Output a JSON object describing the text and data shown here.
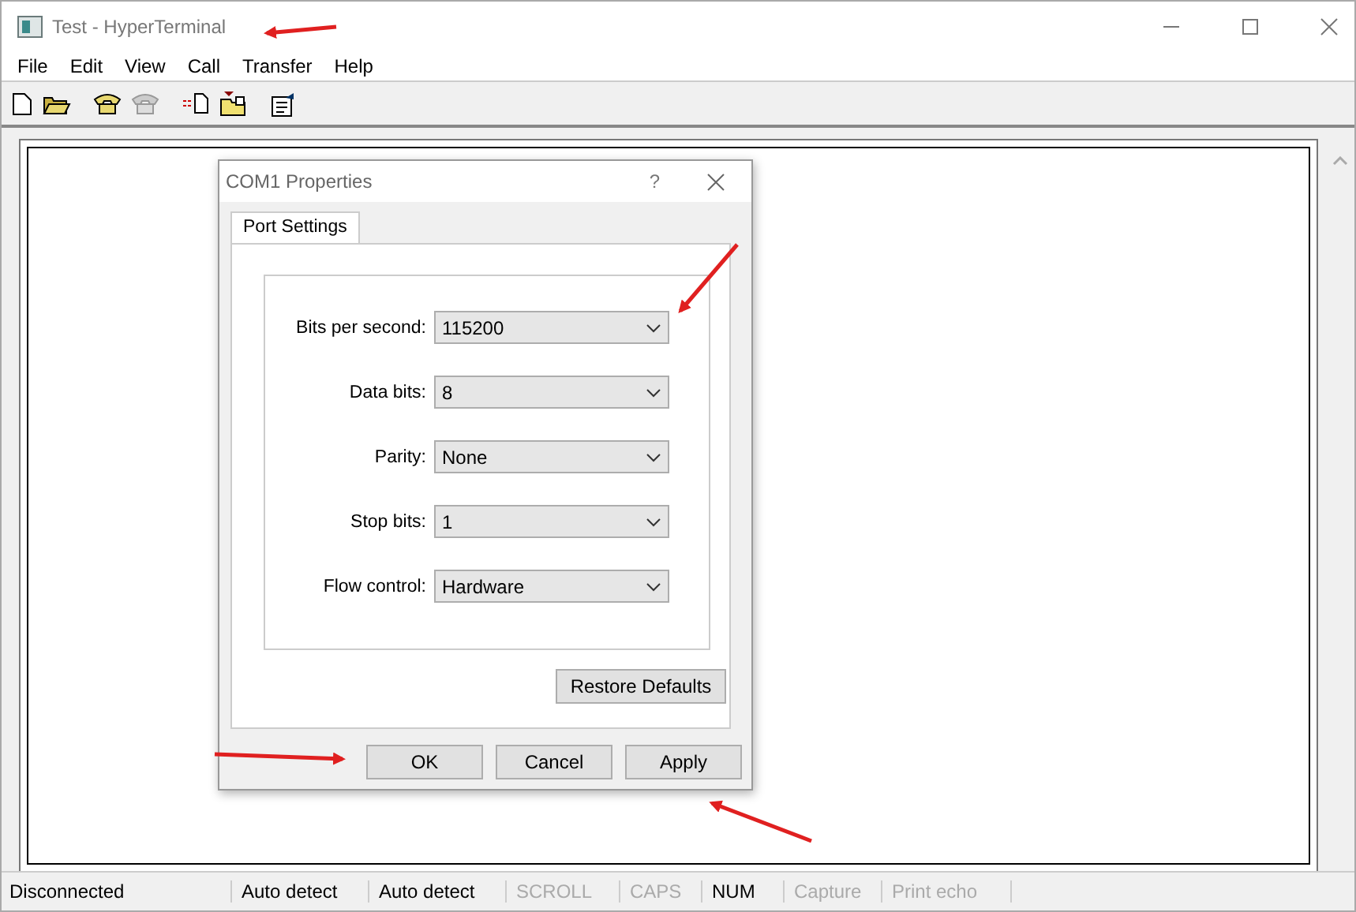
{
  "window": {
    "title": "Test - HyperTerminal"
  },
  "menu": [
    "File",
    "Edit",
    "View",
    "Call",
    "Transfer",
    "Help"
  ],
  "toolbar": [
    {
      "kind": "new"
    },
    {
      "kind": "open"
    },
    {
      "kind": "call",
      "disabled": false
    },
    {
      "kind": "disconnect",
      "disabled": true
    },
    {
      "kind": "send"
    },
    {
      "kind": "receive"
    },
    {
      "kind": "properties"
    }
  ],
  "dialog": {
    "title": "COM1 Properties",
    "help": "?",
    "tabs": [
      {
        "label": "Port Settings",
        "selected": true
      }
    ],
    "fields": [
      {
        "label": "Bits per second:",
        "value": "115200"
      },
      {
        "label": "Data bits:",
        "value": "8"
      },
      {
        "label": "Parity:",
        "value": "None"
      },
      {
        "label": "Stop bits:",
        "value": "1"
      },
      {
        "label": "Flow control:",
        "value": "Hardware"
      }
    ],
    "restore_button": "Restore Defaults",
    "buttons": [
      "OK",
      "Cancel",
      "Apply"
    ]
  },
  "status_bar": [
    {
      "text": "Disconnected",
      "disabled": false
    },
    {
      "text": "Auto detect",
      "disabled": false
    },
    {
      "text": "Auto detect",
      "disabled": false
    },
    {
      "text": "SCROLL",
      "disabled": true
    },
    {
      "text": "CAPS",
      "disabled": true
    },
    {
      "text": "NUM",
      "disabled": false
    },
    {
      "text": "Capture",
      "disabled": true
    },
    {
      "text": "Print echo",
      "disabled": true
    }
  ]
}
